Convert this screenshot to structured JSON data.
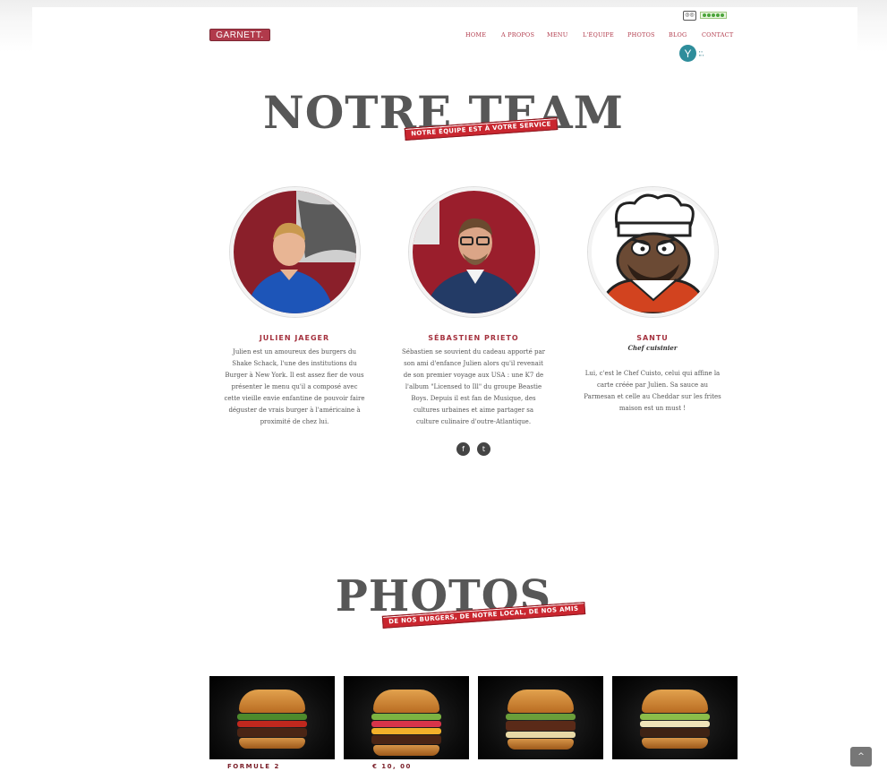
{
  "brand": {
    "logo_text": "GARNETT."
  },
  "header": {
    "tripadvisor_icon": "tripadvisor-icon",
    "rating_icon": "rating-dots-icon"
  },
  "nav": [
    {
      "label": "HOME"
    },
    {
      "label": "A PROPOS"
    },
    {
      "label": "MENU"
    },
    {
      "label": "L'ÉQUIPE"
    },
    {
      "label": "PHOTOS"
    },
    {
      "label": "BLOG"
    },
    {
      "label": "CONTACT"
    }
  ],
  "team_section": {
    "title": "NOTRE TEAM",
    "ribbon": "NOTRE ÉQUIPE EST À VOTRE SERVICE"
  },
  "members": [
    {
      "name": "JULIEN JAEGER",
      "role": "",
      "bio": "Julien est un amoureux des burgers du Shake Schack, l'une des institutions du Burger à New York. Il est assez fier de vous présenter le menu qu'il a composé avec cette vieille envie enfantine de pouvoir faire déguster de vrais burger à l'américaine à proximité de chez lui."
    },
    {
      "name": "SÉBASTIEN PRIETO",
      "role": "",
      "bio": "Sébastien se souvient du cadeau apporté par son ami d'enfance Julien alors qu'il revenait de son premier voyage aux USA : une K7 de l'album \"Licensed to Ill\" du groupe Beastie Boys. Depuis il est fan de Musique, des cultures urbaines et aime partager sa culture culinaire d'outre-Atlantique."
    },
    {
      "name": "SANTU",
      "role": "Chef cuisinier",
      "bio": "Lui, c'est le Chef Cuisto, celui qui affine la carte créée par Julien. Sa sauce au Parmesan et celle au Cheddar sur les frites maison est un must !"
    }
  ],
  "social": {
    "facebook_glyph": "f",
    "twitter_glyph": "t"
  },
  "photos_section": {
    "title": "PHOTOS",
    "ribbon": "DE NOS BURGERS, DE NOTRE LOCAL, DE NOS AMIS"
  },
  "gallery": {
    "caption_left": "FORMULE 2",
    "caption_price": "€ 10, 00"
  },
  "back_to_top": {
    "glyph": "^"
  }
}
